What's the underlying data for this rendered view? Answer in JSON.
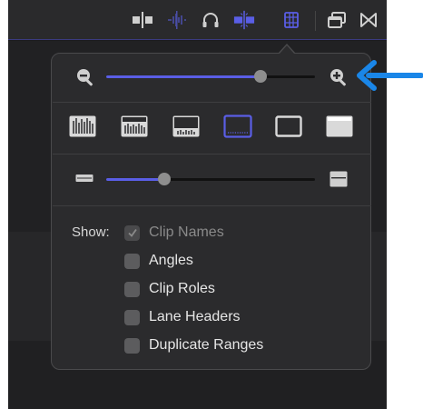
{
  "toolbar": {
    "icons": [
      "split-view-icon",
      "audio-skimming-icon",
      "headphones-icon",
      "snapping-icon",
      "clip-appearance-icon",
      "window-icon",
      "bowtie-icon"
    ],
    "active": "clip-appearance-icon"
  },
  "popover": {
    "zoom": {
      "value": 0.74,
      "zoom_out_icon": "zoom-out-icon",
      "zoom_in_icon": "zoom-in-icon"
    },
    "clip_display_modes": {
      "options": [
        "waveform-only",
        "large-waveform",
        "waveform-filmstrip",
        "large-filmstrip",
        "filmstrip-only",
        "clip-label-only"
      ],
      "selected_index": 3
    },
    "clip_height": {
      "value": 0.28,
      "small_icon": "short-clip-icon",
      "large_icon": "tall-clip-icon"
    },
    "show": {
      "label": "Show:",
      "options": [
        {
          "label": "Clip Names",
          "checked": true,
          "disabled": true
        },
        {
          "label": "Angles",
          "checked": false,
          "disabled": false
        },
        {
          "label": "Clip Roles",
          "checked": false,
          "disabled": false
        },
        {
          "label": "Lane Headers",
          "checked": false,
          "disabled": false
        },
        {
          "label": "Duplicate Ranges",
          "checked": false,
          "disabled": false
        }
      ]
    }
  },
  "annotation": {
    "arrow_color": "#1a86e8"
  },
  "colors": {
    "accent": "#5a5ee6",
    "popover_bg": "#2b2b2d",
    "app_bg": "#1c1c1e"
  }
}
